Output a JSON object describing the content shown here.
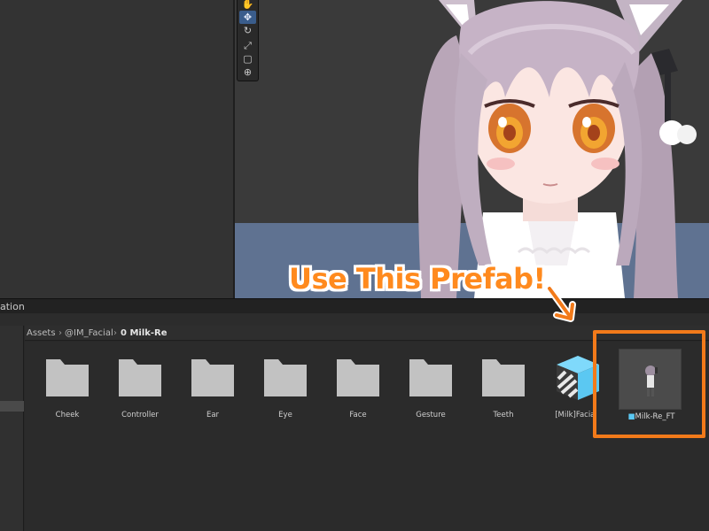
{
  "project_panel": {
    "tab_label": "ation",
    "breadcrumb": [
      {
        "label": "Assets"
      },
      {
        "label": "@IM_Facial"
      },
      {
        "label": "0 Milk-Re"
      }
    ],
    "assets": [
      {
        "label": "Cheek",
        "type": "folder"
      },
      {
        "label": "Controller",
        "type": "folder"
      },
      {
        "label": "Ear",
        "type": "folder"
      },
      {
        "label": "Eye",
        "type": "folder"
      },
      {
        "label": "Face",
        "type": "folder"
      },
      {
        "label": "Gesture",
        "type": "folder"
      },
      {
        "label": "Teeth",
        "type": "folder"
      },
      {
        "label": "[Milk]Facial",
        "type": "asset-cube"
      },
      {
        "label": "Milk-Re_FT",
        "type": "prefab"
      }
    ]
  },
  "annotation": {
    "callout_text": "Use This Prefab!",
    "accent_color": "#f27a1a"
  },
  "scene_tools": [
    "hand-tool",
    "move-tool",
    "rotate-tool",
    "scale-tool",
    "rect-tool",
    "transform-tool"
  ],
  "colors": {
    "folder_icon": "#c2c2c2",
    "cube_icon": "#5bc8f2",
    "active_tool": "#3a5d8c"
  }
}
